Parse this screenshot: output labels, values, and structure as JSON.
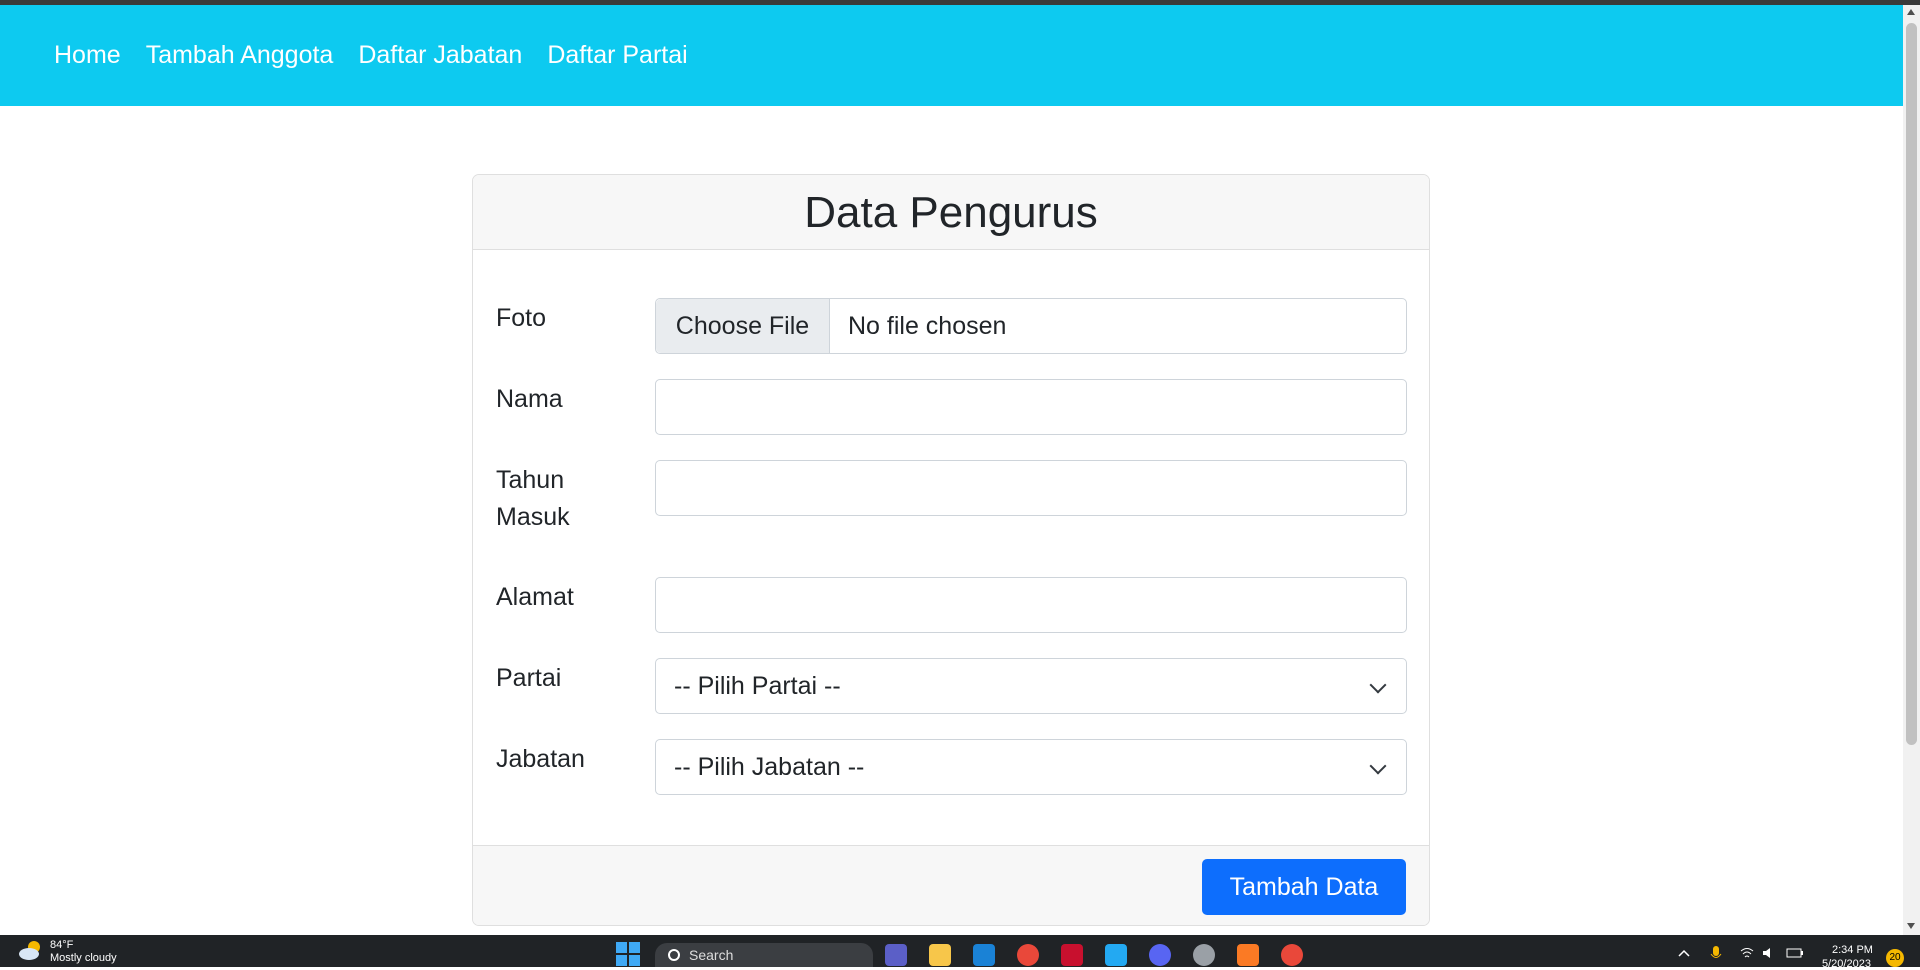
{
  "nav": {
    "items": [
      {
        "label": "Home"
      },
      {
        "label": "Tambah Anggota"
      },
      {
        "label": "Daftar Jabatan"
      },
      {
        "label": "Daftar Partai"
      }
    ]
  },
  "card": {
    "title": "Data Pengurus",
    "fields": {
      "foto": {
        "label": "Foto",
        "button": "Choose File",
        "status": "No file chosen"
      },
      "nama": {
        "label": "Nama",
        "value": ""
      },
      "tahun_masuk": {
        "label_line1": "Tahun",
        "label_line2": "Masuk",
        "value": ""
      },
      "alamat": {
        "label": "Alamat",
        "value": ""
      },
      "partai": {
        "label": "Partai",
        "selected": "-- Pilih Partai --"
      },
      "jabatan": {
        "label": "Jabatan",
        "selected": "-- Pilih Jabatan --"
      }
    },
    "submit_label": "Tambah Data"
  },
  "taskbar": {
    "weather_temp": "84°F",
    "weather_desc": "Mostly cloudy",
    "search_placeholder": "Search",
    "time": "2:34 PM",
    "date": "5/20/2023",
    "notification_count": "20",
    "apps": [
      "meet-icon",
      "file-explorer-icon",
      "mail-icon",
      "chrome-icon",
      "app-red-icon",
      "vscode-icon",
      "discord-icon",
      "whatsapp-icon",
      "xampp-icon",
      "chrome-dev-icon"
    ]
  },
  "colors": {
    "navbar": "#0dcaf0",
    "primary_button": "#0d6efd"
  }
}
